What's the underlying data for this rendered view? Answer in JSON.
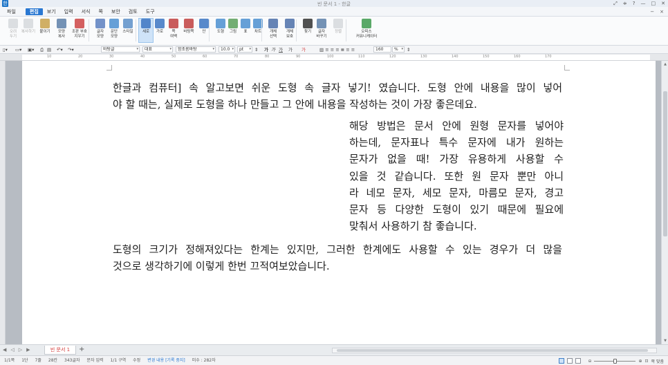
{
  "window": {
    "title": "빈 문서 1 - 한글",
    "app_logo": "한",
    "controls": [
      "⤢",
      "≑",
      "?",
      "—",
      "□",
      "✕"
    ]
  },
  "menu": {
    "items": [
      "파일",
      "편집",
      "보기",
      "입력",
      "서식",
      "쪽",
      "보안",
      "검토",
      "도구"
    ],
    "active_index": 1,
    "right_items": [
      "−",
      "×"
    ]
  },
  "ribbon": {
    "buttons": [
      {
        "label": "오려\n두기",
        "icon": "cut-icon",
        "enabled": false
      },
      {
        "label": "복사하기",
        "icon": "copy-icon",
        "enabled": false
      },
      {
        "label": "붙이기",
        "icon": "paste-icon",
        "enabled": true
      },
      {
        "label": "모양\n복사",
        "icon": "format-painter-icon",
        "enabled": true
      },
      {
        "label": "조판 부호\n지우기",
        "icon": "clear-markup-icon",
        "enabled": true
      },
      {
        "label": "글자\n모양",
        "icon": "char-shape-icon",
        "enabled": true
      },
      {
        "label": "문단\n모양",
        "icon": "para-shape-icon",
        "enabled": true
      },
      {
        "label": "스타일",
        "icon": "style-icon",
        "enabled": true
      },
      {
        "label": "세로",
        "icon": "portrait-icon",
        "enabled": true,
        "selected": true
      },
      {
        "label": "가로",
        "icon": "landscape-icon",
        "enabled": true
      },
      {
        "label": "쪽\n여백",
        "icon": "margin-icon",
        "enabled": true
      },
      {
        "label": "바탕쪽",
        "icon": "master-page-icon",
        "enabled": true
      },
      {
        "label": "단",
        "icon": "columns-icon",
        "enabled": true
      },
      {
        "label": "도형",
        "icon": "shape-icon",
        "enabled": true
      },
      {
        "label": "그림",
        "icon": "picture-icon",
        "enabled": true
      },
      {
        "label": "표",
        "icon": "table-icon",
        "enabled": true
      },
      {
        "label": "차트",
        "icon": "chart-icon",
        "enabled": true
      },
      {
        "label": "개체\n선택",
        "icon": "select-object-icon",
        "enabled": true
      },
      {
        "label": "개체\n보호",
        "icon": "protect-object-icon",
        "enabled": true
      },
      {
        "label": "찾기",
        "icon": "find-icon",
        "enabled": true
      },
      {
        "label": "글자\n바꾸기",
        "icon": "replace-icon",
        "enabled": true
      },
      {
        "label": "정렬",
        "icon": "sort-icon",
        "enabled": false
      },
      {
        "label": "오피스\n커뮤니케이터",
        "icon": "office-communicator-icon",
        "enabled": true
      }
    ]
  },
  "format_bar": {
    "style": "바탕글",
    "lang": "대표",
    "font": "함초롬바탕",
    "size": "10.0",
    "unit": "pt",
    "zoom": "160",
    "zoom_unit": "%",
    "char_buttons": [
      "가",
      "가",
      "가",
      "가",
      "가"
    ]
  },
  "ruler": {
    "numbers": [
      "10",
      "20",
      "30",
      "40",
      "50",
      "60",
      "70",
      "80",
      "90",
      "100",
      "110",
      "120",
      "130",
      "140",
      "150",
      "160",
      "170"
    ]
  },
  "document": {
    "para1": [
      "한글과 컴퓨터] 속 알고보면 쉬운 도형 속 글자 넣기! 였습니다. 도형 안에 내용을 많이 넣어",
      "야 할 때는, 실제로 도형을 하나 만들고 그 안에 내용을 작성하는 것이 가장 좋은데요."
    ],
    "para2": [
      "해당 방법은 문서 안에 원형 문자를 넣어야",
      "하는데, 문자표나 특수 문자에 내가 원하는",
      "문자가 없을 때! 가장 유용하게 사용할 수",
      "있을 것 같습니다. 또한 원 문자 뿐만 아니",
      "라 네모 문자, 세모 문자, 마름모 문자, 경고",
      "문자 등 다양한 도형이 있기 때문에 필요에",
      "맞춰서 사용하기 참 좋습니다."
    ],
    "para3": [
      "도형의 크기가 정해져있다는 한계는 있지만, 그러한 한계에도 사용할 수 있는 경우가 더 많을",
      "것으로 생각하기에 이렇게 한번 끄적여보았습니다."
    ]
  },
  "tabs": {
    "nav": [
      "◀",
      "◁",
      "▷",
      "▶"
    ],
    "doc_tab": "빈 문서 1",
    "add": "+"
  },
  "status": {
    "items": [
      "1/1쪽",
      "1단",
      "7줄",
      "28칸",
      "343글자",
      "문자 입력",
      "1/1 구역",
      "수정"
    ],
    "track": "변경 내용 [기록 중지]",
    "extra": "미수 : 282자",
    "zoom_label": "쪽 맞춤"
  }
}
